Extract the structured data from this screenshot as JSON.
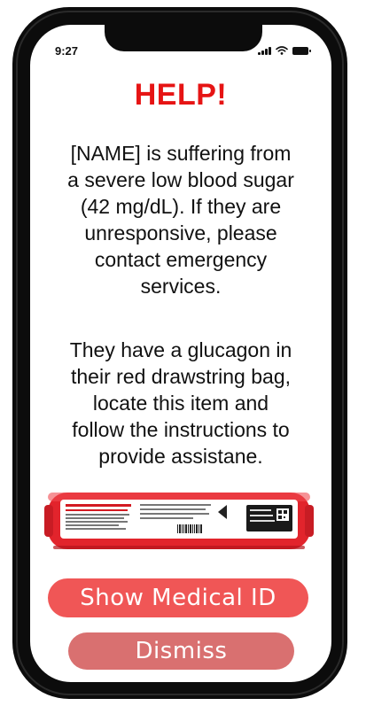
{
  "status_bar": {
    "time": "9:27",
    "icons": [
      "cellular-signal-icon",
      "wifi-icon",
      "battery-icon"
    ]
  },
  "alert": {
    "title": "HELP!",
    "message_lines": [
      "[NAME] is suffering from",
      "a severe low blood sugar",
      "(42 mg/dL). If they are",
      "unresponsive, please",
      "contact emergency",
      "services."
    ],
    "instruction_lines": [
      "They have a glucagon in",
      "their red drawstring bag,",
      "locate this item and",
      "follow the instructions to",
      "provide assistane."
    ]
  },
  "buttons": {
    "show_medical_id": "Show Medical ID",
    "dismiss": "Dismiss"
  },
  "colors": {
    "title": "#e61414",
    "primary_button": "#f05656",
    "secondary_button": "#d97070",
    "device_red": "#e2242c"
  }
}
